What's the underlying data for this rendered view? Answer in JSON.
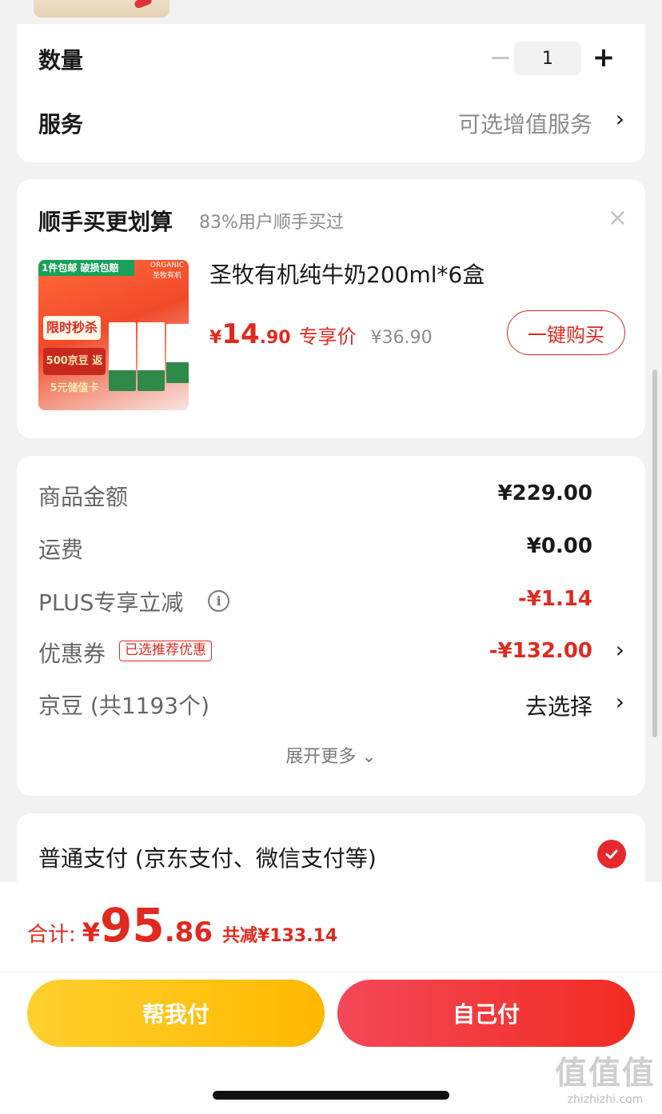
{
  "quantity": {
    "label": "数量",
    "value": "1",
    "minus": "−",
    "plus": "+"
  },
  "service": {
    "label": "服务",
    "value": "可选增值服务",
    "chevron": "›"
  },
  "upsell": {
    "title": "顺手买更划算",
    "subtitle": "83%用户顺手买过",
    "close": "×",
    "product": {
      "image_tag": "1件包邮 破损包赔",
      "image_brand": "ORGANIC 圣牧有机",
      "image_flash": "限时秒杀",
      "image_promo": "500京豆 返5元储值卡",
      "name": "圣牧有机纯牛奶200ml*6盒",
      "price_symbol": "¥",
      "price_int": "14",
      "price_dec": ".90",
      "price_label": "专享价",
      "original_price": "¥36.90",
      "buy_button": "一键购买"
    }
  },
  "detail": {
    "rows": [
      {
        "label": "商品金额",
        "value": "¥229.00"
      },
      {
        "label": "运费",
        "value": "¥0.00"
      },
      {
        "label": "PLUS专享立减",
        "value": "-¥1.14",
        "info_icon": "i"
      },
      {
        "label": "优惠券",
        "tag": "已选推荐优惠",
        "value": "-¥132.00"
      },
      {
        "label": "京豆 (共1193个)",
        "value": "去选择"
      }
    ],
    "chevron": "›",
    "expand": "展开更多 ⌄"
  },
  "payment": {
    "label": "普通支付 (京东支付、微信支付等)",
    "selected": true
  },
  "total": {
    "label": "合计:",
    "symbol": "¥",
    "int": "95",
    "dec": ".86",
    "saved": "共减¥133.14"
  },
  "buttons": {
    "help_pay": "帮我付",
    "self_pay": "自己付"
  },
  "watermark": {
    "logo": "值值值",
    "url": "zhizhizhi.com"
  },
  "colors": {
    "accent_red": "#e0291f",
    "help_yellow": "#ffc400",
    "self_red": "#f2383a"
  }
}
